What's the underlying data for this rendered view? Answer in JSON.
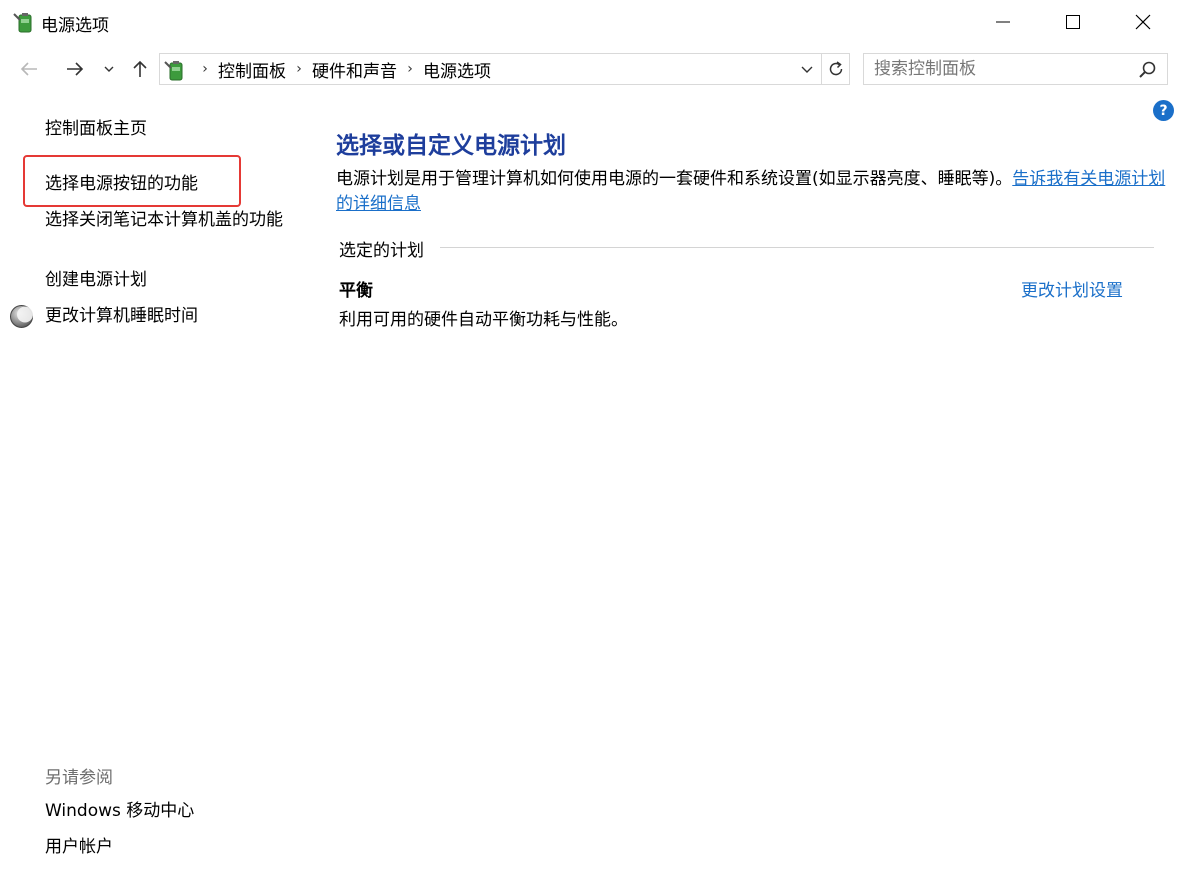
{
  "window": {
    "title": "电源选项",
    "icon": "power-options-battery-icon"
  },
  "navigation": {
    "back": "arrow-left-icon",
    "forward": "arrow-right-icon",
    "recent": "chevron-down-icon",
    "up": "arrow-up-icon"
  },
  "address": {
    "icon": "control-panel-icon",
    "crumbs": [
      "控制面板",
      "硬件和声音",
      "电源选项"
    ]
  },
  "search": {
    "placeholder": "搜索控制面板"
  },
  "sidebar": {
    "home": "控制面板主页",
    "items": [
      "选择电源按钮的功能",
      "选择关闭笔记本计算机盖的功能",
      "创建电源计划",
      "更改计算机睡眠时间"
    ],
    "see_also_title": "另请参阅",
    "see_also": [
      "Windows 移动中心",
      "用户帐户"
    ]
  },
  "main": {
    "title": "选择或自定义电源计划",
    "description": "电源计划是用于管理计算机如何使用电源的一套硬件和系统设置(如显示器亮度、睡眠等)。",
    "description_link": "告诉我有关电源计划的详细信息",
    "section_title": "选定的计划",
    "plan": {
      "name": "平衡",
      "description": "利用可用的硬件自动平衡功耗与性能。",
      "change_link": "更改计划设置"
    }
  },
  "colors": {
    "link": "#1a6fc9",
    "title": "#1e3e9c",
    "highlight": "#e53935"
  }
}
